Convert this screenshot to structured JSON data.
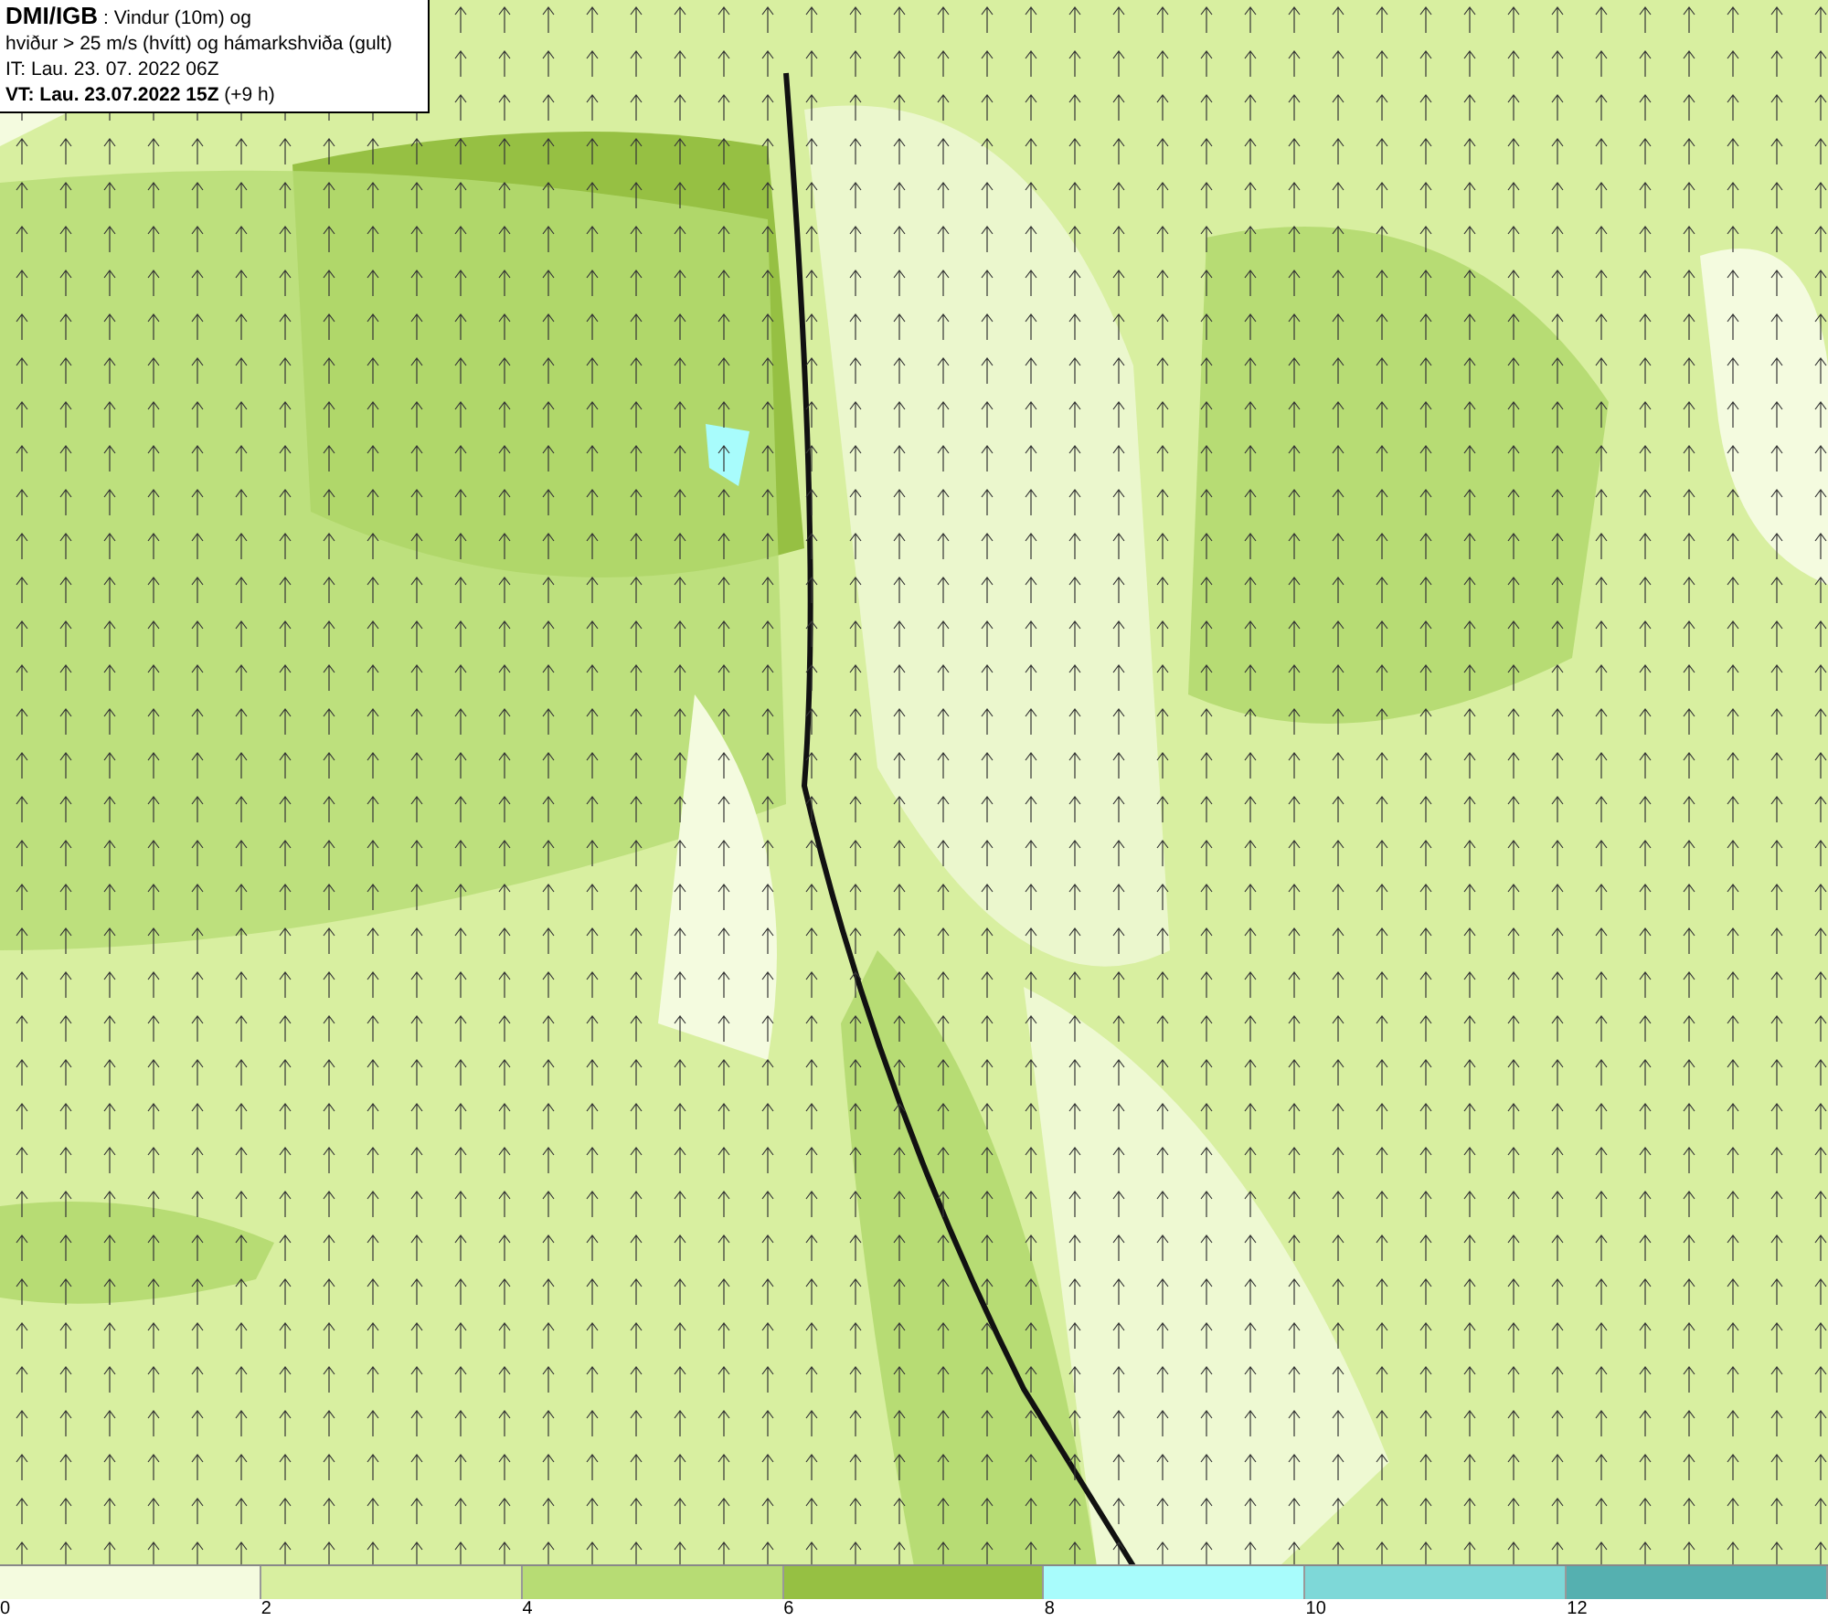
{
  "header": {
    "lines": [
      "**DMI/IGB** : Vindur (10m) og",
      "hviður > 25 m/s (hvítt) og hámarkshviða (gult)",
      "IT: Lau. 23. 07. 2022 06Z",
      "**VT: Lau. 23.07.2022 15Z** (+9 h)"
    ]
  },
  "legend": {
    "segments": [
      {
        "color": "#f4fbdf",
        "label": "0"
      },
      {
        "color": "#d8efa0",
        "label": "2"
      },
      {
        "color": "#b7dc74",
        "label": "4"
      },
      {
        "color": "#96c043",
        "label": "6"
      },
      {
        "color": "#a8fcfc",
        "label": "8"
      },
      {
        "color": "#7ed8d8",
        "label": "10"
      },
      {
        "color": "#55b0b0",
        "label": "12"
      }
    ]
  }
}
